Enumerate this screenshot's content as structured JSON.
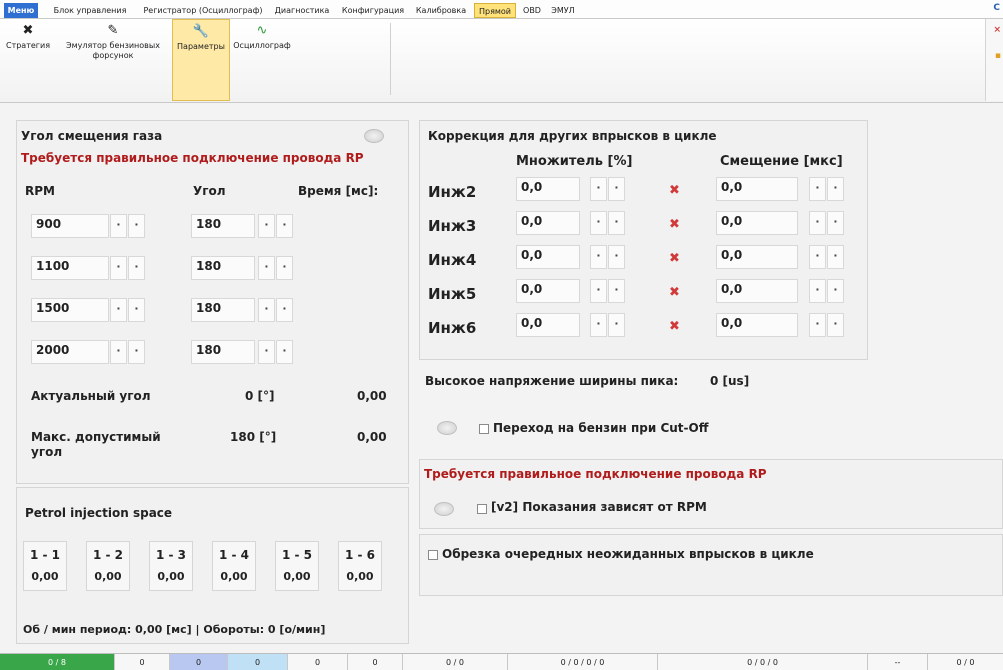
{
  "menu": {
    "items": [
      "Меню",
      "Блок управления",
      "Регистратор (Осциллограф)",
      "Диагностика",
      "Конфигурация",
      "Калибровка",
      "Прямой",
      "OBD",
      "ЭМУЛ"
    ]
  },
  "ribbon": {
    "buttons": [
      {
        "label": "Стратегия",
        "icon": "strategy-icon"
      },
      {
        "label": "Эмулятор бензиновых форсунок",
        "icon": "pen-icon"
      },
      {
        "label": "Параметры",
        "icon": "wrench-icon"
      },
      {
        "label": "Осциллограф",
        "icon": "waveform-icon"
      }
    ]
  },
  "left_panel": {
    "title": "Угол смещения газа",
    "warning": "Требуется правильное подключение провода RP",
    "col_rpm": "RPM",
    "col_angle": "Угол",
    "col_time": "Время [мс]:",
    "rows": [
      {
        "rpm": "900",
        "angle": "180"
      },
      {
        "rpm": "1100",
        "angle": "180"
      },
      {
        "rpm": "1500",
        "angle": "180"
      },
      {
        "rpm": "2000",
        "angle": "180"
      }
    ],
    "actual_label": "Актуальный угол",
    "actual_angle": "0 [°]",
    "actual_time": "0,00",
    "max_label": "Макс. допустимый угол",
    "max_angle": "180 [°]",
    "max_time": "0,00"
  },
  "petrol": {
    "title": "Petrol injection space",
    "cells": [
      {
        "h": "1 - 1",
        "v": "0,00"
      },
      {
        "h": "1 - 2",
        "v": "0,00"
      },
      {
        "h": "1 - 3",
        "v": "0,00"
      },
      {
        "h": "1 - 4",
        "v": "0,00"
      },
      {
        "h": "1 - 5",
        "v": "0,00"
      },
      {
        "h": "1 - 6",
        "v": "0,00"
      }
    ],
    "footer": "Об / мин период: 0,00 [мс]  |  Обороты: 0 [о/мин]"
  },
  "correction": {
    "title": "Коррекция для других впрысков в цикле",
    "col_mult": "Множитель [%]",
    "col_shift": "Смещение [мкс]",
    "rows": [
      {
        "label": "Инж2",
        "mult": "0,0",
        "shift": "0,0"
      },
      {
        "label": "Инж3",
        "mult": "0,0",
        "shift": "0,0"
      },
      {
        "label": "Инж4",
        "mult": "0,0",
        "shift": "0,0"
      },
      {
        "label": "Инж5",
        "mult": "0,0",
        "shift": "0,0"
      },
      {
        "label": "Инж6",
        "mult": "0,0",
        "shift": "0,0"
      }
    ]
  },
  "peak": {
    "label": "Высокое напряжение ширины пика:",
    "value": "0 [us]"
  },
  "cutoff": {
    "label": "Переход на бензин при Cut-Off"
  },
  "rp_panel": {
    "warning": "Требуется правильное подключение провода RP",
    "label": "[v2] Показания зависят от RPM"
  },
  "trim": {
    "label": "Обрезка очередных неожиданных впрысков в цикле"
  },
  "status": {
    "cells": [
      "0 / 8",
      "0",
      "0",
      "0",
      "0",
      "0",
      "0 / 0",
      "0 / 0 / 0 / 0",
      "0 / 0 / 0",
      "--",
      "0 / 0"
    ],
    "colors": {
      "green": "#3aa64a",
      "blue": "#b9c8f0",
      "cyan": "#bfe0f5"
    }
  }
}
